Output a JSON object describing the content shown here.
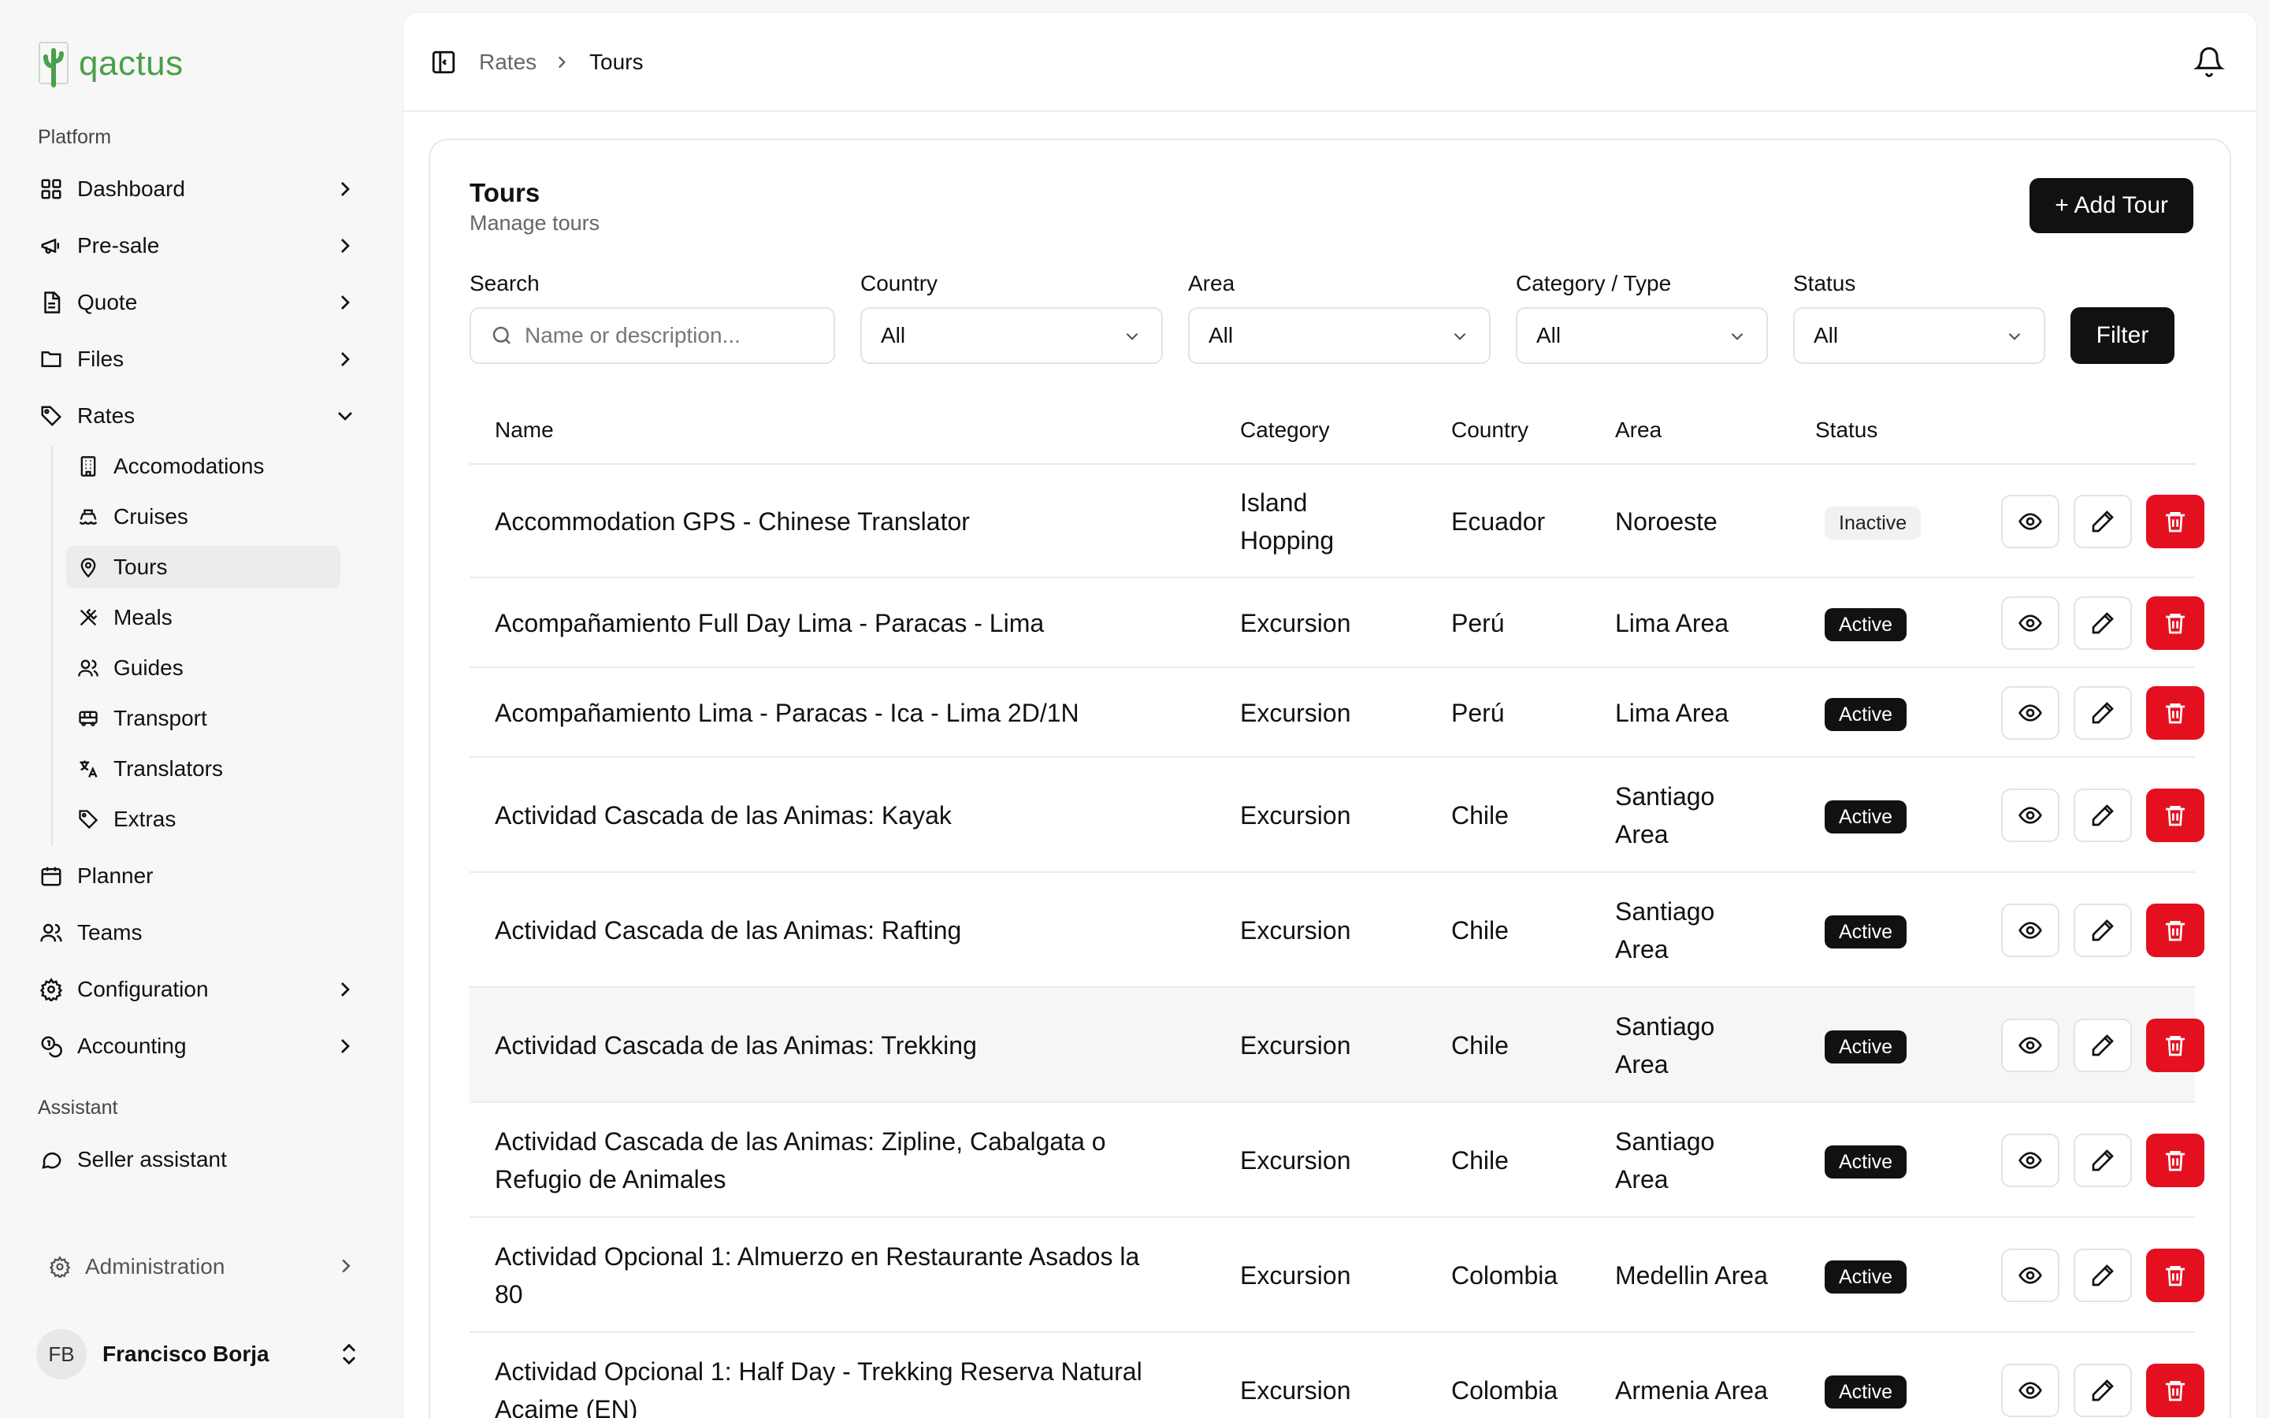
{
  "brand": {
    "name": "qactus",
    "color": "#4aa049"
  },
  "sidebar": {
    "platform_label": "Platform",
    "assistant_label": "Assistant",
    "items": [
      {
        "label": "Dashboard",
        "icon": "grid-icon"
      },
      {
        "label": "Pre-sale",
        "icon": "megaphone-icon"
      },
      {
        "label": "Quote",
        "icon": "document-icon"
      },
      {
        "label": "Files",
        "icon": "folder-icon"
      },
      {
        "label": "Rates",
        "icon": "tag-icon"
      }
    ],
    "rates_subitems": [
      {
        "label": "Accomodations",
        "icon": "building-icon"
      },
      {
        "label": "Cruises",
        "icon": "ship-icon"
      },
      {
        "label": "Tours",
        "icon": "map-pin-icon"
      },
      {
        "label": "Meals",
        "icon": "utensils-icon"
      },
      {
        "label": "Guides",
        "icon": "users-icon"
      },
      {
        "label": "Transport",
        "icon": "bus-icon"
      },
      {
        "label": "Translators",
        "icon": "languages-icon"
      },
      {
        "label": "Extras",
        "icon": "tag-icon"
      }
    ],
    "lower_items": [
      {
        "label": "Planner",
        "icon": "calendar-icon"
      },
      {
        "label": "Teams",
        "icon": "users-icon"
      },
      {
        "label": "Configuration",
        "icon": "gear-icon"
      },
      {
        "label": "Accounting",
        "icon": "coins-icon"
      }
    ],
    "assistant_item": {
      "label": "Seller assistant",
      "icon": "chat-icon"
    },
    "admin": {
      "label": "Administration",
      "icon": "gear-icon"
    },
    "user": {
      "initials": "FB",
      "name": "Francisco Borja"
    }
  },
  "header": {
    "breadcrumb": [
      "Rates",
      "Tours"
    ]
  },
  "page": {
    "title": "Tours",
    "subtitle": "Manage tours",
    "add_button": "+ Add Tour"
  },
  "filters": {
    "search_label": "Search",
    "search_placeholder": "Name or description...",
    "country_label": "Country",
    "country_value": "All",
    "area_label": "Area",
    "area_value": "All",
    "category_label": "Category / Type",
    "category_value": "All",
    "status_label": "Status",
    "status_value": "All",
    "filter_button": "Filter"
  },
  "table": {
    "columns": [
      "Name",
      "Category",
      "Country",
      "Area",
      "Status"
    ],
    "rows": [
      {
        "name": "Accommodation GPS - Chinese Translator",
        "category": "Island Hopping",
        "country": "Ecuador",
        "area": "Noroeste",
        "status": "Inactive"
      },
      {
        "name": "Acompañamiento Full Day Lima - Paracas - Lima",
        "category": "Excursion",
        "country": "Perú",
        "area": "Lima Area",
        "status": "Active"
      },
      {
        "name": "Acompañamiento Lima - Paracas - Ica - Lima 2D/1N",
        "category": "Excursion",
        "country": "Perú",
        "area": "Lima Area",
        "status": "Active"
      },
      {
        "name": "Actividad Cascada de las Animas: Kayak",
        "category": "Excursion",
        "country": "Chile",
        "area": "Santiago Area",
        "status": "Active"
      },
      {
        "name": "Actividad Cascada de las Animas: Rafting",
        "category": "Excursion",
        "country": "Chile",
        "area": "Santiago Area",
        "status": "Active"
      },
      {
        "name": "Actividad Cascada de las Animas: Trekking",
        "category": "Excursion",
        "country": "Chile",
        "area": "Santiago Area",
        "status": "Active"
      },
      {
        "name": "Actividad Cascada de las Animas: Zipline, Cabalgata o Refugio de Animales",
        "category": "Excursion",
        "country": "Chile",
        "area": "Santiago Area",
        "status": "Active"
      },
      {
        "name": "Actividad Opcional 1: Almuerzo en Restaurante Asados la 80",
        "category": "Excursion",
        "country": "Colombia",
        "area": "Medellin Area",
        "status": "Active"
      },
      {
        "name": "Actividad Opcional 1: Half Day - Trekking Reserva Natural Acaime (EN)",
        "category": "Excursion",
        "country": "Colombia",
        "area": "Armenia Area",
        "status": "Active"
      }
    ]
  },
  "colors": {
    "delete": "#e4101f",
    "primary": "#111111"
  }
}
